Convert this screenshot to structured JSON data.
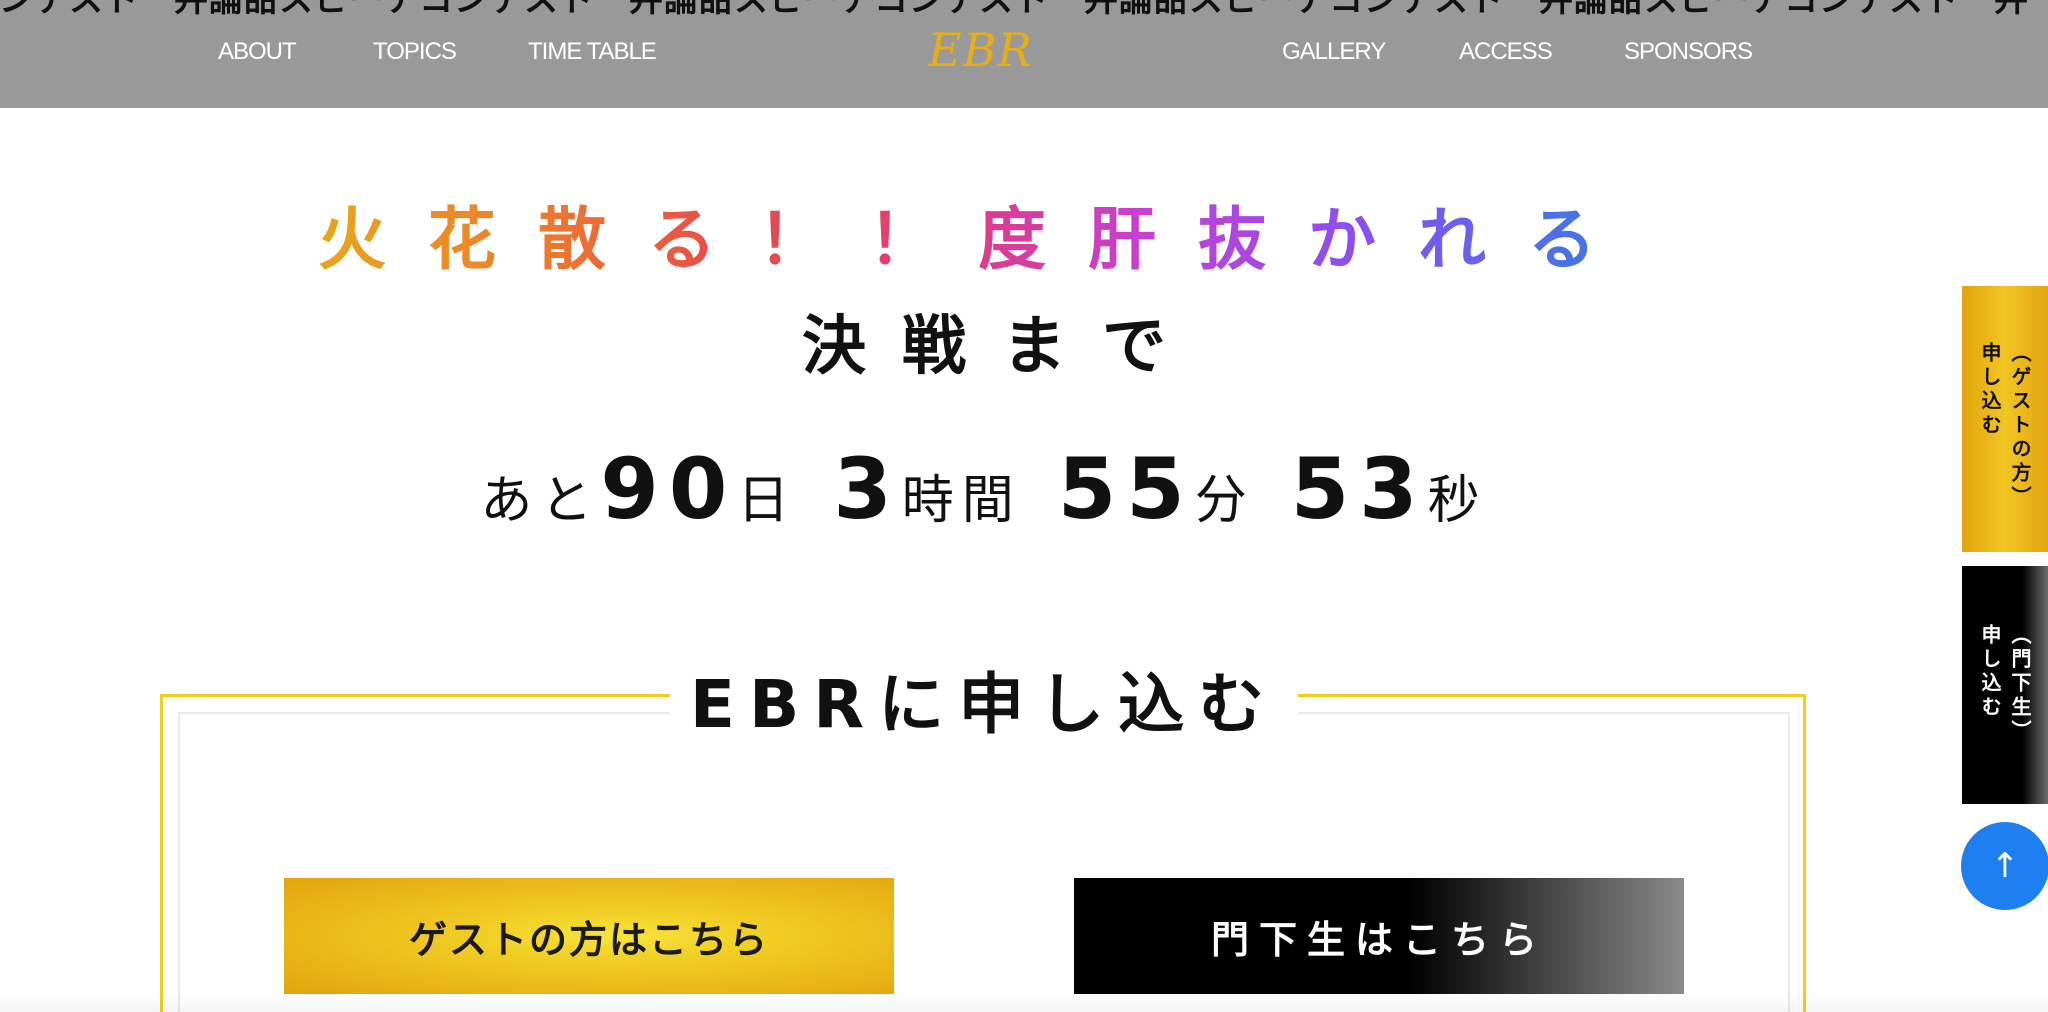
{
  "header": {
    "marquee_text": "コンテスト　弁論甜スピーチコンテスト　弁論甜スピーチコンテスト　弁論甜スピーチコンテスト　弁論甜スピーチコンテスト　弁",
    "logo": "EBR",
    "nav": {
      "about": "ABOUT",
      "topics": "TOPICS",
      "timetable": "TIME TABLE",
      "gallery": "GALLERY",
      "access": "ACCESS",
      "sponsors": "SPONSORS"
    }
  },
  "hero": {
    "headline": "火花散る！！度肝抜かれる",
    "subhead": "決戦まで",
    "countdown": {
      "prefix": "あと",
      "days": "90",
      "days_unit": "日",
      "hours": "3",
      "hours_unit": "時間",
      "minutes": "55",
      "minutes_unit": "分",
      "seconds": "53",
      "seconds_unit": "秒"
    }
  },
  "apply": {
    "title": "EBRに申し込む",
    "guest_button": "ゲストの方はこちら",
    "member_button": "門下生はこちら"
  },
  "side_tabs": {
    "guest": {
      "line1": "（ゲストの方）",
      "line2": "申し込む"
    },
    "member": {
      "line1": "（門下生）",
      "line2": "申し込む"
    }
  },
  "to_top": {
    "arrow": "↑"
  },
  "colors": {
    "header_bg": "#999999",
    "logo": "#e6ad1b",
    "frame_yellow": "#f2cf1b",
    "guest_gold": "#f0cd23",
    "to_top_blue": "#1e7ff0"
  }
}
